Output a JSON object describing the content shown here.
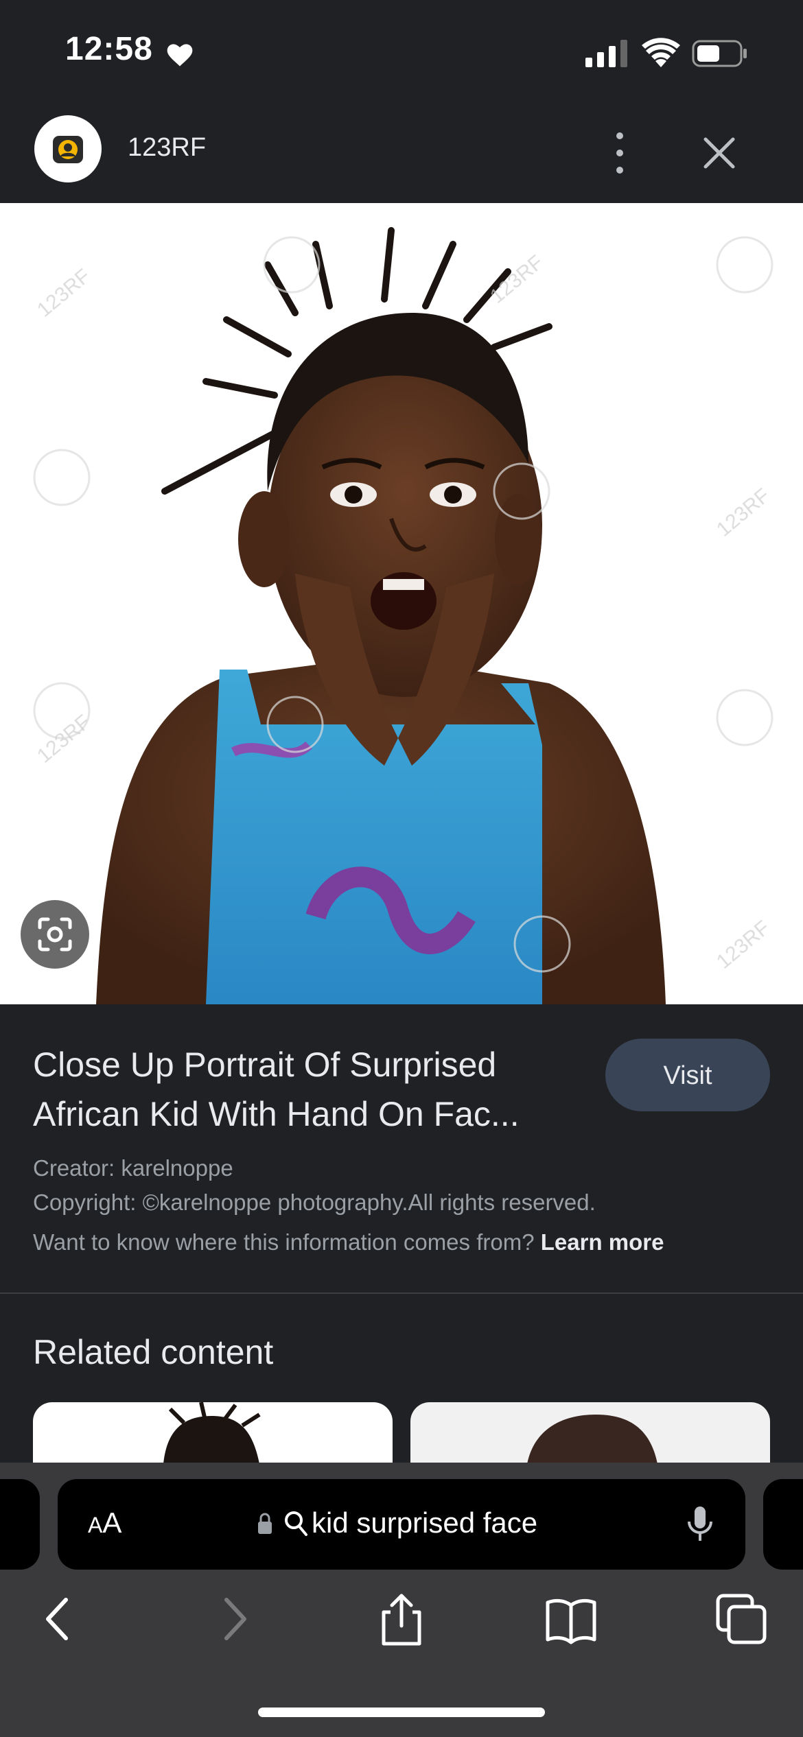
{
  "status_bar": {
    "time": "12:58",
    "icons": [
      "heart-icon",
      "cellular-signal-icon",
      "wifi-icon",
      "battery-icon"
    ]
  },
  "header": {
    "site_name": "123RF",
    "icons": [
      "site-logo-icon",
      "more-vertical-icon",
      "close-icon"
    ]
  },
  "image": {
    "watermark": "123RF",
    "lens_icon": "google-lens-icon"
  },
  "info": {
    "title": "Close Up Portrait Of Surprised African Kid With Hand On Fac...",
    "visit_label": "Visit",
    "creator": "Creator: karelnoppe",
    "copyright": "Copyright: ©karelnoppe photography.All rights reserved.",
    "source_question": "Want to know where this information comes from?",
    "learn_more": "Learn more"
  },
  "related": {
    "title": "Related content"
  },
  "browser": {
    "text_size_label_small": "A",
    "text_size_label_large": "A",
    "search_query": "kid surprised face",
    "nav_icons": [
      "back-icon",
      "forward-icon",
      "share-icon",
      "bookmarks-icon",
      "tabs-icon"
    ]
  },
  "colors": {
    "background": "#202124",
    "visit_button": "#394457",
    "toolbar": "#3a3a3c"
  }
}
